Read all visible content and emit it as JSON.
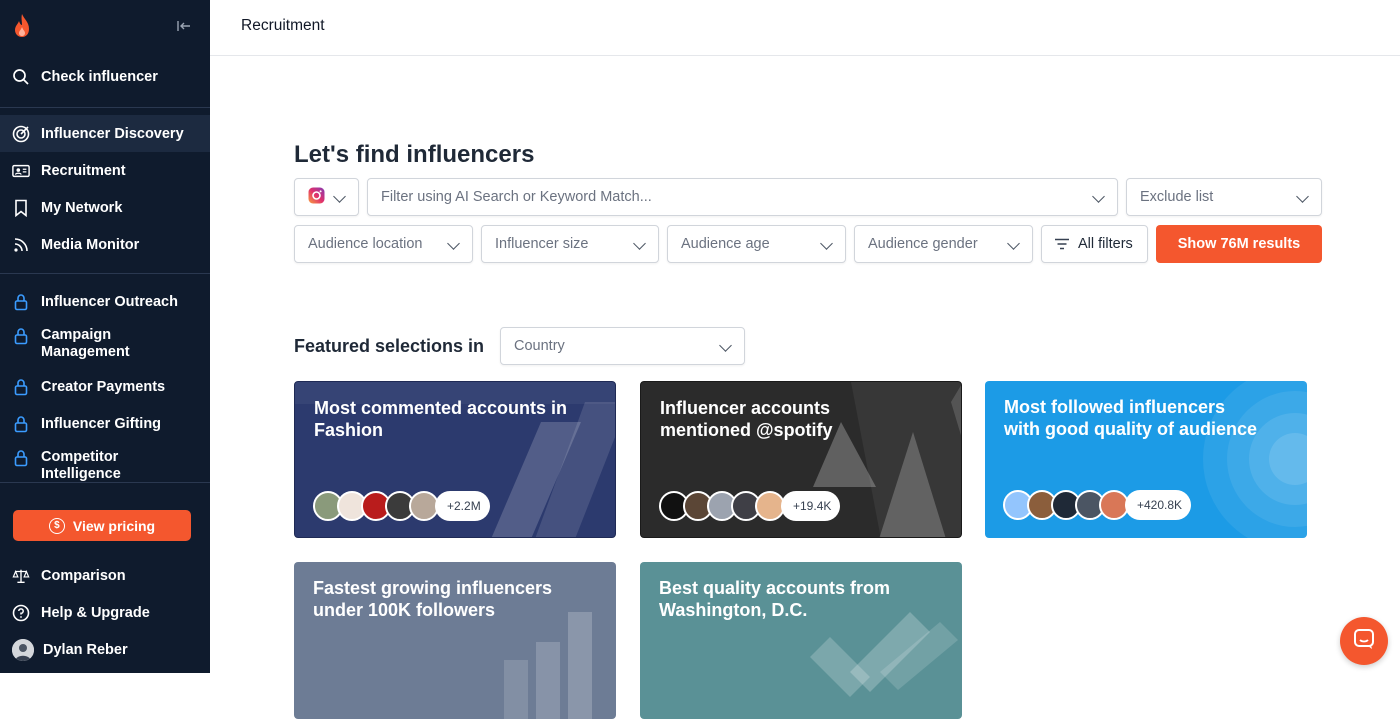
{
  "sidebar": {
    "check_influencer": "Check influencer",
    "items": [
      {
        "label": "Influencer Discovery"
      },
      {
        "label": "Recruitment"
      },
      {
        "label": "My Network"
      },
      {
        "label": "Media Monitor"
      }
    ],
    "locked_items": [
      {
        "label": "Influencer Outreach"
      },
      {
        "label": "Campaign Management"
      },
      {
        "label": "Creator Payments"
      },
      {
        "label": "Influencer Gifting"
      },
      {
        "label": "Competitor Intelligence"
      }
    ],
    "pricing_label": "View pricing",
    "comparison": "Comparison",
    "help": "Help & Upgrade",
    "user_name": "Dylan Reber"
  },
  "topbar": {
    "title": "Recruitment"
  },
  "search": {
    "heading": "Let's find influencers",
    "platform": "instagram-icon",
    "filter_placeholder": "Filter using AI Search or Keyword Match...",
    "exclude_label": "Exclude list",
    "filters": [
      {
        "label": "Audience location"
      },
      {
        "label": "Influencer size"
      },
      {
        "label": "Audience age"
      },
      {
        "label": "Audience gender"
      }
    ],
    "all_filters_label": "All filters",
    "show_results_label": "Show 76M results"
  },
  "featured": {
    "title": "Featured selections in",
    "country_label": "Country",
    "cards": [
      {
        "title": "Most commented accounts in Fashion",
        "count": "+2.2M",
        "color": "#2c3a6e"
      },
      {
        "title": "Influencer accounts mentioned @spotify",
        "count": "+19.4K",
        "color": "#2b2b2b"
      },
      {
        "title": "Most followed influencers with good quality of audience",
        "count": "+420.8K",
        "color": "#1c9be6"
      },
      {
        "title": "Fastest growing influencers under 100K followers",
        "count": "",
        "color": "#6d7c95"
      },
      {
        "title": "Best quality accounts from Washington, D.C.",
        "count": "",
        "color": "#5a9196"
      }
    ]
  },
  "colors": {
    "accent": "#f4572e",
    "sidebar_bg": "#0f1b2d"
  }
}
